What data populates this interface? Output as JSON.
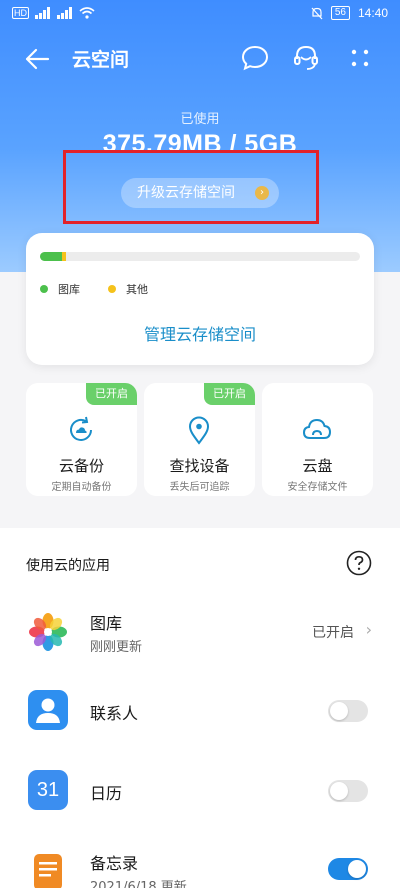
{
  "status": {
    "network_left": "HD",
    "battery": "56",
    "time": "14:40"
  },
  "app_bar": {
    "title": "云空间"
  },
  "storage": {
    "used_label": "已使用",
    "used_value": "375.79MB / 5GB",
    "upgrade_label": "升级云存储空间",
    "gallery_fraction": 0.07,
    "other_fraction": 0.01,
    "legend": [
      {
        "label": "图库",
        "color": "#4cc04c"
      },
      {
        "label": "其他",
        "color": "#f5c21b"
      }
    ],
    "manage_label": "管理云存储空间"
  },
  "features": [
    {
      "name": "云备份",
      "sub": "定期自动备份",
      "badge": "已开启",
      "icon": "cloud-backup-icon"
    },
    {
      "name": "查找设备",
      "sub": "丢失后可追踪",
      "badge": "已开启",
      "icon": "location-pin-icon"
    },
    {
      "name": "云盘",
      "sub": "安全存储文件",
      "badge": "",
      "icon": "cloud-drive-icon"
    }
  ],
  "apps": {
    "header": "使用云的应用",
    "items": [
      {
        "name": "图库",
        "sub": "刚刚更新",
        "status": "已开启",
        "toggle": null
      },
      {
        "name": "联系人",
        "sub": "",
        "status": "",
        "toggle": false
      },
      {
        "name": "日历",
        "sub": "",
        "status": "",
        "toggle": false,
        "icon_text": "31"
      },
      {
        "name": "备忘录",
        "sub": "2021/6/18 更新",
        "status": "",
        "toggle": true
      }
    ]
  }
}
